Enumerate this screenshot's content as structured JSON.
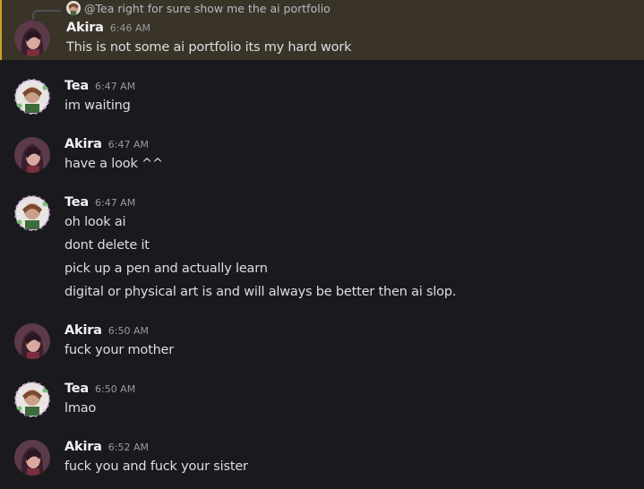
{
  "colors": {
    "background": "#1a1a1e",
    "highlight_bg": "#3a3428",
    "highlight_border": "#c9a227",
    "username": "#f2f3f5",
    "timestamp": "#949ba4",
    "text": "#dbdee1"
  },
  "reply": {
    "mention": "@Tea",
    "text": "right for sure show me the ai portfolio",
    "avatar_icon": "tea-avatar-icon"
  },
  "messages": [
    {
      "author": "Akira",
      "time": "6:46 AM",
      "lines": [
        "This is not some ai portfolio its my hard work"
      ],
      "avatar_icon": "akira-avatar-icon",
      "highlighted": true
    },
    {
      "author": "Tea",
      "time": "6:47 AM",
      "lines": [
        "im waiting"
      ],
      "avatar_icon": "tea-avatar-icon"
    },
    {
      "author": "Akira",
      "time": "6:47 AM",
      "lines": [
        "have a look ^^"
      ],
      "avatar_icon": "akira-avatar-icon"
    },
    {
      "author": "Tea",
      "time": "6:47 AM",
      "lines": [
        "oh look ai",
        "dont delete it",
        "pick up a pen and actually learn",
        "digital or physical art is and will always be better then ai slop."
      ],
      "avatar_icon": "tea-avatar-icon"
    },
    {
      "author": "Akira",
      "time": "6:50 AM",
      "lines": [
        "fuck your mother"
      ],
      "avatar_icon": "akira-avatar-icon"
    },
    {
      "author": "Tea",
      "time": "6:50 AM",
      "lines": [
        "lmao"
      ],
      "avatar_icon": "tea-avatar-icon"
    },
    {
      "author": "Akira",
      "time": "6:52 AM",
      "lines": [
        "fuck you and fuck your sister"
      ],
      "avatar_icon": "akira-avatar-icon"
    }
  ]
}
